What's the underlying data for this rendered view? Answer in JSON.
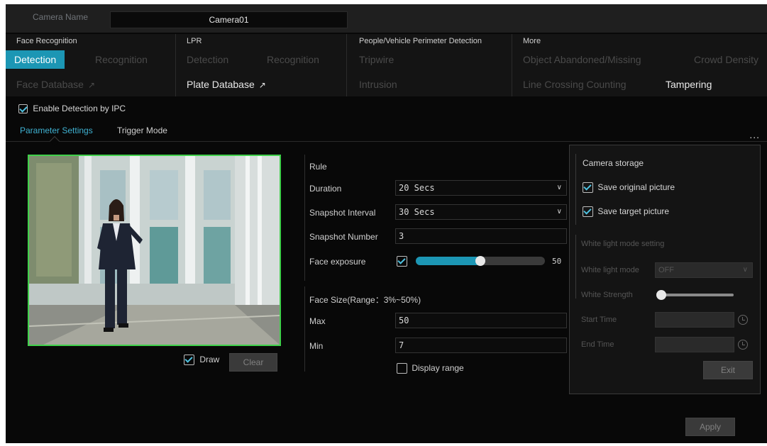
{
  "header": {
    "camera_name_label": "Camera Name",
    "camera_name_value": "Camera01"
  },
  "sections": {
    "face_recognition": {
      "title": "Face Recognition",
      "detection": "Detection",
      "recognition": "Recognition",
      "face_database": "Face Database"
    },
    "lpr": {
      "title": "LPR",
      "detection": "Detection",
      "recognition": "Recognition",
      "plate_database": "Plate Database"
    },
    "perimeter": {
      "title": "People/Vehicle Perimeter Detection",
      "tripwire": "Tripwire",
      "intrusion": "Intrusion"
    },
    "more": {
      "title": "More",
      "object_abandoned": "Object Abandoned/Missing",
      "crowd_density": "Crowd Density",
      "line_crossing": "Line Crossing Counting",
      "tampering": "Tampering"
    }
  },
  "enable_detection": {
    "label": "Enable Detection by IPC",
    "checked": true
  },
  "tabs": {
    "parameter_settings": "Parameter Settings",
    "trigger_mode": "Trigger Mode",
    "more": "..."
  },
  "preview": {
    "draw_label": "Draw",
    "draw_checked": true,
    "clear_label": "Clear"
  },
  "rule": {
    "title": "Rule",
    "duration_label": "Duration",
    "duration_value": "20 Secs",
    "snapshot_interval_label": "Snapshot Interval",
    "snapshot_interval_value": "30 Secs",
    "snapshot_number_label": "Snapshot Number",
    "snapshot_number_value": "3",
    "face_exposure_label": "Face exposure",
    "face_exposure_checked": true,
    "face_exposure_value": "50",
    "face_exposure_level": 0.5,
    "face_size_label": "Face Size(Range：3%~50%)",
    "max_label": "Max",
    "max_value": "50",
    "min_label": "Min",
    "min_value": "7",
    "display_range_label": "Display range",
    "display_range_checked": false
  },
  "storage_panel": {
    "camera_storage_title": "Camera storage",
    "save_original_label": "Save original picture",
    "save_original_checked": true,
    "save_target_label": "Save target picture",
    "save_target_checked": true,
    "white_light_title": "White light mode setting",
    "white_light_mode_label": "White light mode",
    "white_light_mode_value": "OFF",
    "white_strength_label": "White Strength",
    "white_strength_level": 0,
    "start_time_label": "Start Time",
    "end_time_label": "End Time",
    "exit_label": "Exit"
  },
  "apply_label": "Apply",
  "colors": {
    "accent": "#1c96b4",
    "background": "#080808",
    "detection_box": "#3fd04a"
  }
}
